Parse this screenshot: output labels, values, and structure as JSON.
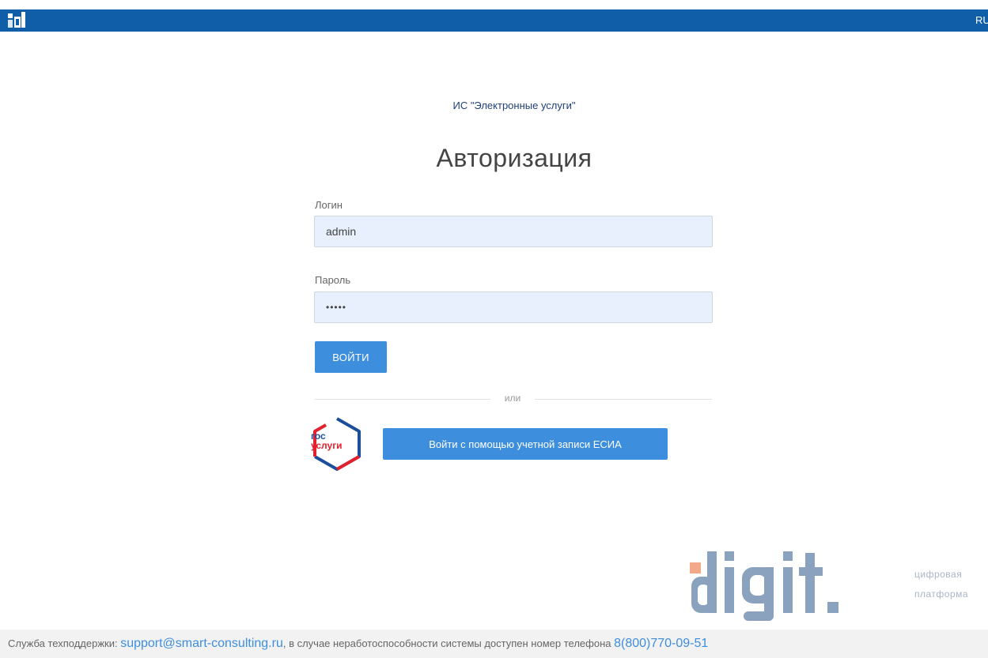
{
  "header": {
    "logo_icon": "site-logo-icon",
    "lang_label": "RU",
    "bar_color": "#0f5ea7"
  },
  "login": {
    "system_title": "ИС \"Электронные услуги\"",
    "heading": "Авторизация",
    "login_label": "Логин",
    "login_value": "admin",
    "password_label": "Пароль",
    "password_value": "•••••",
    "submit_label": "ВОЙТИ",
    "divider_text": "или",
    "gosuslugi_top": "гос",
    "gosuslugi_bottom": "услуги",
    "esia_button_label": "Войти с помощью учетной записи ЕСИА",
    "accent_color": "#3e8ede"
  },
  "branding": {
    "digit_text": "digit.",
    "caption_line1": "цифровая",
    "caption_line2": "платформа"
  },
  "footer": {
    "support_prefix": "Служба техподдержки: ",
    "support_email": "support@smart-consulting.ru",
    "support_middle": ", в случае неработоспособности системы доступен номер телефона ",
    "support_phone": "8(800)770-09-51"
  }
}
